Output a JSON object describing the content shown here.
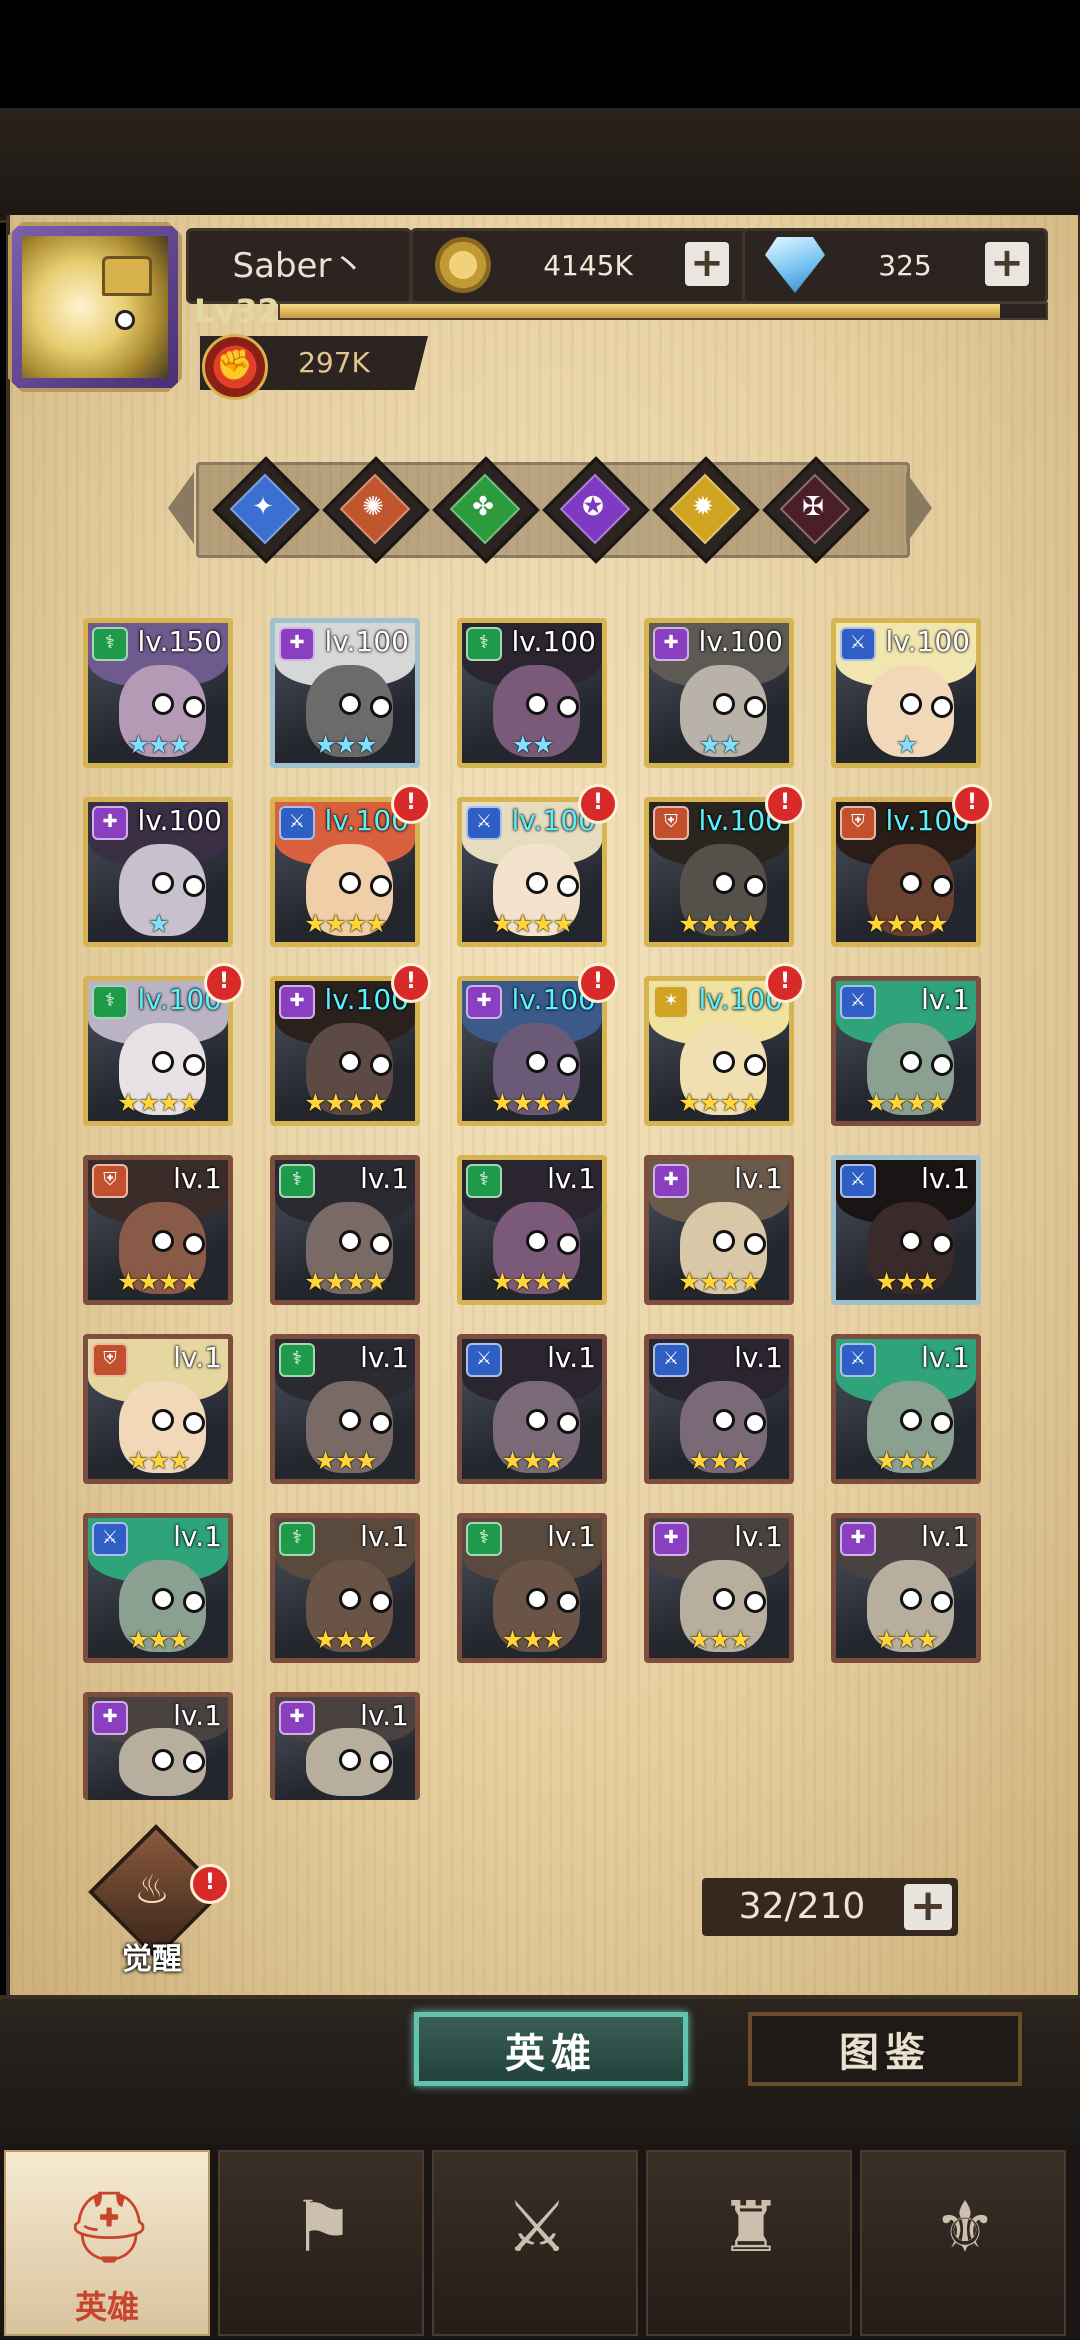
{
  "player": {
    "name": "Saber丶",
    "level": "Lv32",
    "xp_fraction": 0.94,
    "power": "297K"
  },
  "resources": {
    "gold": "4145K",
    "diamonds": "325"
  },
  "faction_filters": [
    {
      "name": "faction-light",
      "color": "#3b6fd0",
      "glyph": "✦"
    },
    {
      "name": "faction-fire",
      "color": "#c0562e",
      "glyph": "✺"
    },
    {
      "name": "faction-nature",
      "color": "#2e9a3e",
      "glyph": "✤"
    },
    {
      "name": "faction-arcane",
      "color": "#7c3bc1",
      "glyph": "✪"
    },
    {
      "name": "faction-holy",
      "color": "#d1a323",
      "glyph": "✹"
    },
    {
      "name": "faction-dark",
      "color": "#4a1f2a",
      "glyph": "✠"
    }
  ],
  "heroes": [
    {
      "level": "lv.150",
      "stars": 3,
      "frame": "gold",
      "badge": "#1f9a4a",
      "star_color": "blue",
      "lvl_color": "white",
      "alert": false,
      "skin": "#b59ab5",
      "hair": "#6e5a8c"
    },
    {
      "level": "lv.100",
      "stars": 3,
      "frame": "silver",
      "badge": "#8a3fc0",
      "star_color": "blue",
      "lvl_color": "white",
      "alert": false,
      "skin": "#6d6a6a",
      "hair": "#d7d7d7"
    },
    {
      "level": "lv.100",
      "stars": 2,
      "frame": "gold",
      "badge": "#1f9a4a",
      "star_color": "blue",
      "lvl_color": "white",
      "alert": false,
      "skin": "#7a5a78",
      "hair": "#2b2530"
    },
    {
      "level": "lv.100",
      "stars": 2,
      "frame": "gold",
      "badge": "#8a3fc0",
      "star_color": "blue",
      "lvl_color": "white",
      "alert": false,
      "skin": "#b8b2a8",
      "hair": "#5d5a56"
    },
    {
      "level": "lv.100",
      "stars": 1,
      "frame": "gold",
      "badge": "#2f5fc4",
      "star_color": "blue",
      "lvl_color": "white",
      "alert": false,
      "skin": "#f0d8b8",
      "hair": "#f1e6b0"
    },
    {
      "level": "lv.100",
      "stars": 1,
      "frame": "gold",
      "badge": "#8a3fc0",
      "star_color": "blue",
      "lvl_color": "white",
      "alert": false,
      "skin": "#c7c0cd",
      "hair": "#3a2f44"
    },
    {
      "level": "lv.100",
      "stars": 4,
      "frame": "gold",
      "badge": "#2f5fc4",
      "star_color": "gold",
      "lvl_color": "cyan",
      "alert": true,
      "skin": "#f0cfa8",
      "hair": "#d9603c"
    },
    {
      "level": "lv.100",
      "stars": 4,
      "frame": "gold",
      "badge": "#2f5fc4",
      "star_color": "gold",
      "lvl_color": "cyan",
      "alert": true,
      "skin": "#f3e3cc",
      "hair": "#e8dcc0"
    },
    {
      "level": "lv.100",
      "stars": 4,
      "frame": "gold",
      "badge": "#c2502d",
      "star_color": "gold",
      "lvl_color": "cyan",
      "alert": true,
      "skin": "#55504a",
      "hair": "#2b2520"
    },
    {
      "level": "lv.100",
      "stars": 4,
      "frame": "gold",
      "badge": "#c2502d",
      "star_color": "gold",
      "lvl_color": "cyan",
      "alert": true,
      "skin": "#6a4030",
      "hair": "#2a1c16"
    },
    {
      "level": "lv.100",
      "stars": 4,
      "frame": "gold",
      "badge": "#1f9a4a",
      "star_color": "gold",
      "lvl_color": "cyan",
      "alert": true,
      "skin": "#e8e2e6",
      "hair": "#b9b3c4"
    },
    {
      "level": "lv.100",
      "stars": 4,
      "frame": "gold",
      "badge": "#8a3fc0",
      "star_color": "gold",
      "lvl_color": "cyan",
      "alert": true,
      "skin": "#5e4a44",
      "hair": "#2a211d"
    },
    {
      "level": "lv.100",
      "stars": 4,
      "frame": "gold",
      "badge": "#8a3fc0",
      "star_color": "gold",
      "lvl_color": "cyan",
      "alert": true,
      "skin": "#6a5a78",
      "hair": "#3b5a8a"
    },
    {
      "level": "lv.100",
      "stars": 4,
      "frame": "gold",
      "badge": "#d1a323",
      "star_color": "gold",
      "lvl_color": "cyan",
      "alert": true,
      "skin": "#f0dfb0",
      "hair": "#f0e2a0"
    },
    {
      "level": "lv.1",
      "stars": 4,
      "frame": "copper",
      "badge": "#2f5fc4",
      "star_color": "gold",
      "lvl_color": "white",
      "alert": false,
      "skin": "#8aa090",
      "hair": "#2fa37a"
    },
    {
      "level": "lv.1",
      "stars": 4,
      "frame": "copper",
      "badge": "#c2502d",
      "star_color": "gold",
      "lvl_color": "white",
      "alert": false,
      "skin": "#8a5a48",
      "hair": "#3a2c28"
    },
    {
      "level": "lv.1",
      "stars": 4,
      "frame": "copper",
      "badge": "#1f9a4a",
      "star_color": "gold",
      "lvl_color": "white",
      "alert": false,
      "skin": "#7a6a66",
      "hair": "#2b2a30"
    },
    {
      "level": "lv.1",
      "stars": 4,
      "frame": "gold",
      "badge": "#1f9a4a",
      "star_color": "gold",
      "lvl_color": "white",
      "alert": false,
      "skin": "#7a5a78",
      "hair": "#2b2530"
    },
    {
      "level": "lv.1",
      "stars": 4,
      "frame": "copper",
      "badge": "#8a3fc0",
      "star_color": "gold",
      "lvl_color": "white",
      "alert": false,
      "skin": "#d8c8a8",
      "hair": "#6a5a4a"
    },
    {
      "level": "lv.1",
      "stars": 3,
      "frame": "silver",
      "badge": "#2f5fc4",
      "star_color": "gold",
      "lvl_color": "white",
      "alert": false,
      "skin": "#3a2a2a",
      "hair": "#1a1414"
    },
    {
      "level": "lv.1",
      "stars": 3,
      "frame": "copper",
      "badge": "#c2502d",
      "star_color": "gold",
      "lvl_color": "white",
      "alert": false,
      "skin": "#f0d8b8",
      "hair": "#e6d6a0"
    },
    {
      "level": "lv.1",
      "stars": 3,
      "frame": "copper",
      "badge": "#1f9a4a",
      "star_color": "gold",
      "lvl_color": "white",
      "alert": false,
      "skin": "#7a6a66",
      "hair": "#2b2a30"
    },
    {
      "level": "lv.1",
      "stars": 3,
      "frame": "copper",
      "badge": "#2f5fc4",
      "star_color": "gold",
      "lvl_color": "white",
      "alert": false,
      "skin": "#7a6a78",
      "hair": "#2a2530"
    },
    {
      "level": "lv.1",
      "stars": 3,
      "frame": "copper",
      "badge": "#2f5fc4",
      "star_color": "gold",
      "lvl_color": "white",
      "alert": false,
      "skin": "#7a6a78",
      "hair": "#2a2530"
    },
    {
      "level": "lv.1",
      "stars": 3,
      "frame": "copper",
      "badge": "#2f5fc4",
      "star_color": "gold",
      "lvl_color": "white",
      "alert": false,
      "skin": "#8aa090",
      "hair": "#2fa37a"
    },
    {
      "level": "lv.1",
      "stars": 3,
      "frame": "copper",
      "badge": "#2f5fc4",
      "star_color": "gold",
      "lvl_color": "white",
      "alert": false,
      "skin": "#8aa090",
      "hair": "#2fa37a"
    },
    {
      "level": "lv.1",
      "stars": 3,
      "frame": "copper",
      "badge": "#1f9a4a",
      "star_color": "gold",
      "lvl_color": "white",
      "alert": false,
      "skin": "#6a5448",
      "hair": "#5a4a3e"
    },
    {
      "level": "lv.1",
      "stars": 3,
      "frame": "copper",
      "badge": "#1f9a4a",
      "star_color": "gold",
      "lvl_color": "white",
      "alert": false,
      "skin": "#6a5448",
      "hair": "#5a4a3e"
    },
    {
      "level": "lv.1",
      "stars": 3,
      "frame": "copper",
      "badge": "#8a3fc0",
      "star_color": "gold",
      "lvl_color": "white",
      "alert": false,
      "skin": "#b8ae9e",
      "hair": "#4a4240"
    },
    {
      "level": "lv.1",
      "stars": 3,
      "frame": "copper",
      "badge": "#8a3fc0",
      "star_color": "gold",
      "lvl_color": "white",
      "alert": false,
      "skin": "#b8ae9e",
      "hair": "#4a4240"
    },
    {
      "level": "lv.1",
      "stars": 0,
      "frame": "copper",
      "badge": "#8a3fc0",
      "star_color": "gold",
      "lvl_color": "white",
      "alert": false,
      "skin": "#b8ae9e",
      "hair": "#4a4240"
    },
    {
      "level": "lv.1",
      "stars": 0,
      "frame": "copper",
      "badge": "#8a3fc0",
      "star_color": "gold",
      "lvl_color": "white",
      "alert": false,
      "skin": "#b8ae9e",
      "hair": "#4a4240"
    }
  ],
  "awaken": {
    "label": "觉醒"
  },
  "capacity": "32/210",
  "tabs": {
    "heroes": "英雄",
    "codex": "图鉴"
  },
  "bottom_nav": [
    {
      "name": "nav-heroes",
      "label": "英雄",
      "icon": "helmet-icon",
      "glyph": "⛑",
      "active": true
    },
    {
      "name": "nav-adventure",
      "label": "",
      "icon": "ship-wheel-flag-icon",
      "glyph": "⚑",
      "active": false
    },
    {
      "name": "nav-battle",
      "label": "",
      "icon": "crossed-swords-icon",
      "glyph": "⚔",
      "active": false
    },
    {
      "name": "nav-tower",
      "label": "",
      "icon": "castle-icon",
      "glyph": "♜",
      "active": false
    },
    {
      "name": "nav-guild",
      "label": "",
      "icon": "handshake-crest-icon",
      "glyph": "⚜",
      "active": false
    }
  ],
  "class_glyphs": {
    "#1f9a4a": "⚕",
    "#8a3fc0": "✚",
    "#2f5fc4": "⚔",
    "#c2502d": "⛨",
    "#d1a323": "✶"
  }
}
